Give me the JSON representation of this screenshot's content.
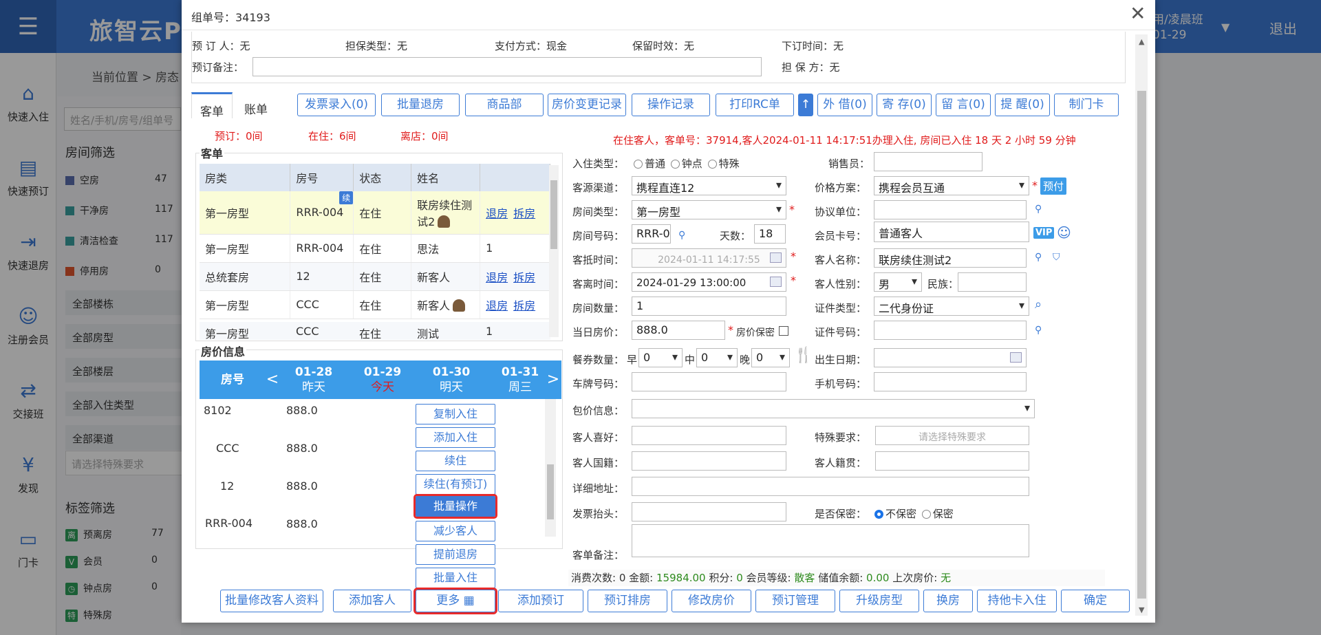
{
  "app": {
    "title": "旅智云P",
    "user_line1": "用/凌晨班",
    "user_line2": "01-29",
    "logout": "退出"
  },
  "nav": [
    "快速入住",
    "快速预订",
    "快速退房",
    "注册会员",
    "交接班",
    "发现",
    "门卡"
  ],
  "breadcrumb": "当前位置 > 房态",
  "left": {
    "search_placeholder": "姓名/手机/房号/组单号",
    "room_filter_title": "房间筛选",
    "room_status": [
      {
        "label": "空房",
        "count": "47",
        "color": "#5a6fb0"
      },
      {
        "label": "干净房",
        "count": "117",
        "color": "#3aa0a0"
      },
      {
        "label": "清洁检查",
        "count": "117",
        "color": "#3aa0a0"
      },
      {
        "label": "停用房",
        "count": "0",
        "color": "#e2552d"
      }
    ],
    "selectors": [
      "全部楼栋",
      "全部房型",
      "全部楼层",
      "全部入住类型",
      "全部渠道"
    ],
    "special_placeholder": "请选择特殊要求",
    "tag_filter_title": "标签筛选",
    "tags": [
      {
        "icon": "离",
        "label": "预离房",
        "count": "77"
      },
      {
        "icon": "V",
        "label": "会员",
        "count": "0"
      },
      {
        "icon": "◷",
        "label": "钟点房",
        "count": "0"
      },
      {
        "icon": "特",
        "label": "特殊房",
        "count": ""
      }
    ]
  },
  "modal": {
    "title": "组单号：34193",
    "resv": {
      "booker_label": "预 订 人：",
      "booker": "无",
      "guarantee_label": "担保类型：",
      "guarantee": "无",
      "payment_label": "支付方式：",
      "payment": "现金",
      "retention_label": "保留时效：",
      "retention": "无",
      "order_time_label": "下订时间：",
      "order_time": "无",
      "note_label": "预订备注：",
      "note": "",
      "guarantor_label": "担 保 方：",
      "guarantor": "无"
    },
    "tabs": [
      "客单",
      "账单"
    ],
    "toolbar": [
      "发票录入(0)",
      "批量退房",
      "商品部",
      "房价变更记录",
      "操作记录",
      "打印RC单",
      "↑",
      "外 借(0)",
      "寄 存(0)",
      "留 言(0)",
      "提 醒(0)",
      "制门卡"
    ],
    "stats": {
      "reserved": "预订：0间",
      "inhouse": "在住：6间",
      "checkout": "离店：0间"
    },
    "inhouse_msg": "在住客人，客单号：37914,客人2024-01-11 14:17:51办理入住, 房间已入住 18 天 2 小时 59 分钟",
    "guest_section": "客单",
    "guest_cols": [
      "房类",
      "房号",
      "状态",
      "姓名",
      ""
    ],
    "guests": [
      {
        "type": "第一房型",
        "room": "RRR-004",
        "status": "在住",
        "name": "联房续住测试2",
        "a1": "退房",
        "a2": "拆房",
        "badge": "续"
      },
      {
        "type": "第一房型",
        "room": "RRR-004",
        "status": "在住",
        "name": "思法",
        "a1": "1",
        "a2": "",
        "badge": ""
      },
      {
        "type": "总统套房",
        "room": "12",
        "status": "在住",
        "name": "新客人",
        "a1": "退房",
        "a2": "拆房",
        "badge": ""
      },
      {
        "type": "第一房型",
        "room": "CCC",
        "status": "在住",
        "name": "新客人",
        "a1": "退房",
        "a2": "拆房",
        "badge": ""
      },
      {
        "type": "第一房型",
        "room": "CCC",
        "status": "在住",
        "name": "测试",
        "a1": "1",
        "a2": "",
        "badge": ""
      }
    ],
    "price_section": "房价信息",
    "price_head": {
      "room": "房号",
      "prev": "<",
      "next": ">",
      "days": [
        {
          "date": "01-28",
          "label": "昨天"
        },
        {
          "date": "01-29",
          "label": "今天"
        },
        {
          "date": "01-30",
          "label": "明天"
        },
        {
          "date": "01-31",
          "label": "周三"
        }
      ]
    },
    "price_rows": [
      {
        "room": "8102",
        "price": "888.0"
      },
      {
        "room": "CCC",
        "price": "888.0"
      },
      {
        "room": "12",
        "price": "888.0"
      },
      {
        "room": "RRR-004",
        "price": "888.0"
      }
    ],
    "more_menu": [
      "复制入住",
      "添加入住",
      "续住",
      "续住(有预订)",
      "批量操作",
      "减少客人",
      "提前退房",
      "批量入住"
    ],
    "form": {
      "checkin_type_label": "入住类型：",
      "checkin_types": [
        "普通",
        "钟点",
        "特殊"
      ],
      "salesman_label": "销售员：",
      "salesman": "",
      "channel_label": "客源渠道：",
      "channel": "携程直连12",
      "rate_plan_label": "价格方案：",
      "rate_plan": "携程会员互通",
      "prepay": "预付",
      "room_type_label": "房间类型：",
      "room_type": "第一房型",
      "agreement_label": "协议单位：",
      "agreement": "",
      "room_no_label": "房间号码：",
      "room_no": "RRR-0",
      "days_label": "天数：",
      "days": "18",
      "member_card_label": "会员卡号：",
      "member_card": "普通客人",
      "vip": "VIP",
      "arrive_label": "客抵时间：",
      "arrive": "2024-01-11 14:17:55",
      "guest_name_label": "客人名称：",
      "guest_name": "联房续住测试2",
      "depart_label": "客离时间：",
      "depart": "2024-01-29 13:00:00",
      "gender_label": "客人性别：",
      "gender": "男",
      "ethnic_label": "民族：",
      "ethnic": "",
      "room_count_label": "房间数量：",
      "room_count": "1",
      "id_type_label": "证件类型：",
      "id_type": "二代身份证",
      "day_rate_label": "当日房价：",
      "day_rate": "888.0",
      "rate_secret_label": "房价保密",
      "id_no_label": "证件号码：",
      "id_no": "",
      "meal_label": "餐券数量：",
      "breakfast_label": "早",
      "breakfast": "0",
      "lunch_label": "中",
      "lunch": "0",
      "dinner_label": "晚",
      "dinner": "0",
      "birth_label": "出生日期：",
      "birth": "",
      "plate_label": "车牌号码：",
      "plate": "",
      "mobile_label": "手机号码：",
      "mobile": "",
      "package_label": "包价信息：",
      "package": "",
      "hobby_label": "客人喜好：",
      "hobby": "",
      "special_label": "特殊要求：",
      "special_placeholder": "请选择特殊要求",
      "nationality_label": "客人国籍：",
      "nationality": "",
      "native_label": "客人籍贯：",
      "native": "",
      "address_label": "详细地址：",
      "address": "",
      "invoice_label": "发票抬头：",
      "invoice": "",
      "secret_label": "是否保密：",
      "secret_options": [
        "不保密",
        "保密"
      ],
      "remark_label": "客单备注：",
      "remark": ""
    },
    "summary": {
      "visits_label": "消费次数:",
      "visits": "0",
      "amount_label": "金额:",
      "amount": "15984.00",
      "points_label": "积分:",
      "points": "0",
      "level_label": "会员等级:",
      "level": "散客",
      "balance_label": "储值余额:",
      "balance": "0.00",
      "last_rate_label": "上次房价:",
      "last_rate": "无"
    },
    "bottom_buttons": [
      "批量修改客人资料",
      "添加客人",
      "更多",
      "添加预订",
      "预订排房",
      "修改房价",
      "预订管理",
      "升级房型",
      "换房",
      "持他卡入住",
      "确定"
    ]
  }
}
